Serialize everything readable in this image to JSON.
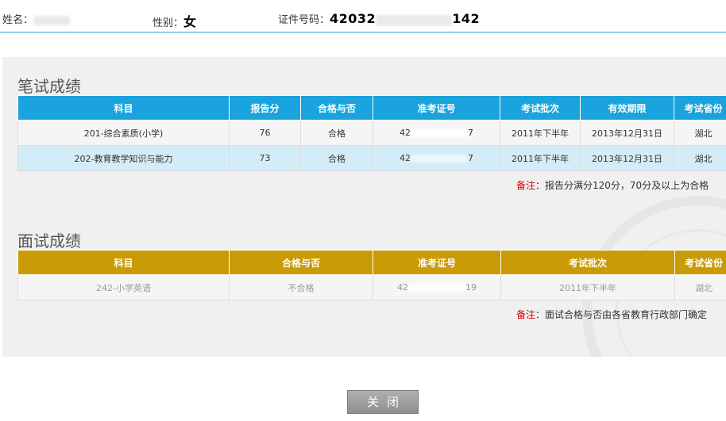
{
  "header": {
    "name_label": "姓名：",
    "name_value": "",
    "gender_label": "性别：",
    "gender_value": "女",
    "id_label": "证件号码：",
    "id_prefix": "42032",
    "id_suffix": "142"
  },
  "written": {
    "title": "笔试成绩",
    "columns": [
      "科目",
      "报告分",
      "合格与否",
      "准考证号",
      "考试批次",
      "有效期限",
      "考试省份"
    ],
    "rows": [
      {
        "subject": "201-综合素质(小学)",
        "score": "76",
        "pass": "合格",
        "ticket_prefix": "42",
        "ticket_suffix": "7",
        "batch": "2011年下半年",
        "valid_until": "2013年12月31日",
        "province": "湖北"
      },
      {
        "subject": "202-教育教学知识与能力",
        "score": "73",
        "pass": "合格",
        "ticket_prefix": "42",
        "ticket_suffix": "7",
        "batch": "2011年下半年",
        "valid_until": "2013年12月31日",
        "province": "湖北"
      }
    ],
    "note_label": "备注",
    "note_text": "：报告分满分120分，70分及以上为合格"
  },
  "interview": {
    "title": "面试成绩",
    "columns": [
      "科目",
      "合格与否",
      "准考证号",
      "考试批次",
      "考试省份"
    ],
    "rows": [
      {
        "subject": "242-小学英语",
        "pass": "不合格",
        "ticket_prefix": "42",
        "ticket_suffix": "19",
        "batch": "2011年下半年",
        "province": "湖北"
      }
    ],
    "note_label": "备注",
    "note_text": "：面试合格与否由各省教育行政部门确定"
  },
  "close_button": {
    "label": "关闭"
  },
  "colors": {
    "written_header": "#1aa3dc",
    "interview_header": "#c99b06",
    "note_label": "#d8000c",
    "header_rule": "#2aa3d4"
  }
}
